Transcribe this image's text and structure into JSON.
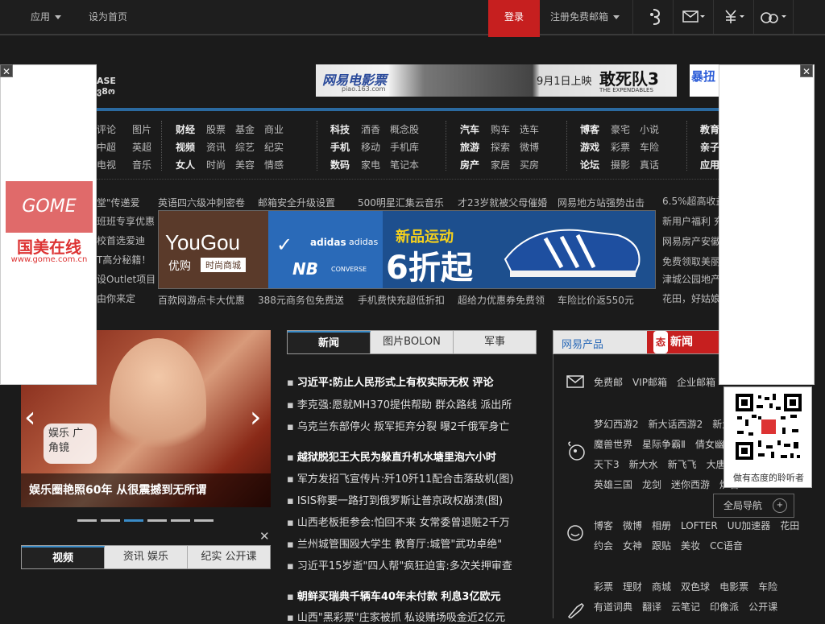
{
  "topbar": {
    "apps": "应用",
    "set_home": "设为首页",
    "login": "登录",
    "register": "注册免费邮箱"
  },
  "movie_ad": {
    "brand": "网易电影票",
    "site": "piao.163.com",
    "date": "9月1日上映",
    "title": "敢死队3",
    "subtitle": "THE EXPENDABLES"
  },
  "nav": {
    "col0": [
      [
        "评论",
        "图片"
      ],
      [
        "中超",
        "英超"
      ],
      [
        "电视",
        "音乐"
      ]
    ],
    "col1": [
      [
        "财经",
        "股票",
        "基金",
        "商业"
      ],
      [
        "视频",
        "资讯",
        "综艺",
        "纪实"
      ],
      [
        "女人",
        "时尚",
        "美容",
        "情感"
      ]
    ],
    "col2": [
      [
        "科技",
        "酒香",
        "概念股"
      ],
      [
        "手机",
        "移动",
        "手机库"
      ],
      [
        "数码",
        "家电",
        "笔记本"
      ]
    ],
    "col3": [
      [
        "汽车",
        "购车",
        "选车"
      ],
      [
        "旅游",
        "探索",
        "微博"
      ],
      [
        "房产",
        "家居",
        "买房"
      ]
    ],
    "col4": [
      [
        "博客",
        "豪宅",
        "小说"
      ],
      [
        "游戏",
        "彩票",
        "车险"
      ],
      [
        "论坛",
        "摄影",
        "真话"
      ]
    ],
    "col5": [
      "教育",
      "亲子",
      "应用"
    ]
  },
  "links_top": [
    "堂\"传递爱",
    "英语四六级冲刺密卷",
    "邮箱安全升级设置",
    "500明星汇集云音乐",
    "才23岁就被父母催婚",
    "网易地方站强势出击",
    "6.5%超高收益"
  ],
  "links_left": [
    "堂\"传递爱",
    "班班专享优惠",
    "校首选爱迪",
    "T高分秘籍！",
    "设Outlet项目",
    "由你来定"
  ],
  "links_right": [
    "新用户福利 充",
    "网易房产安徽",
    "免费领取美丽",
    "津城公园地产",
    "花田，好姑娘"
  ],
  "links_bottom": [
    "百款网游点卡大优惠",
    "388元商务包免费送",
    "手机费快充超低折扣",
    "超给力优惠券免费领",
    "车险比价返550元"
  ],
  "yougou_ad": {
    "brand": "YouGou",
    "brand_cn": "优购",
    "tag": "时尚商城",
    "promo": "新品运动",
    "discount": "6折起",
    "b1": "adidas",
    "b2": "adidas",
    "b3": "NB",
    "b4": "CONVERSE"
  },
  "gome_ad": {
    "logo": "GOME",
    "name": "国美在线",
    "url": "www.gome.com.cn"
  },
  "feature": {
    "badge": "娱乐 广角镜",
    "caption": "娱乐圈艳照60年 从很震撼到无所谓"
  },
  "news_tabs": [
    "新闻",
    "图片BOLON",
    "军事"
  ],
  "news": [
    {
      "text": "习近平:防止人民形式上有权实际无权 评论",
      "bold": true
    },
    {
      "text": "李克强:愿就MH370提供帮助 群众路线 派出所",
      "bold": false
    },
    {
      "text": "乌克兰东部停火 叛军拒弃分裂 曝2千俄军身亡",
      "bold": false
    },
    {
      "text": "越狱脱犯王大民为躲直升机水塘里泡六小时",
      "bold": true
    },
    {
      "text": "军方发招飞宣传片:歼10歼11配合击落敌机(图)",
      "bold": false
    },
    {
      "text": "ISIS称要一路打到俄罗斯让普京政权崩溃(图)",
      "bold": false
    },
    {
      "text": "山西老板拒参会:怕回不来 女常委曾退赃2千万",
      "bold": false
    },
    {
      "text": "兰州城管围殴大学生 教育厅:城管\"武功卓绝\"",
      "bold": false
    },
    {
      "text": "习近平15岁逝\"四人帮\"疯狂迫害:多次关押审查",
      "bold": false
    },
    {
      "text": "朝鲜买瑞典千辆车40年未付款 利息3亿欧元",
      "bold": true
    },
    {
      "text": "山西\"黑彩票\"庄家被抓 私设赌场吸金近2亿元",
      "bold": false
    }
  ],
  "video_tabs": [
    "视频",
    "资讯 娱乐",
    "纪实 公开课"
  ],
  "products": {
    "tab": "网易产品",
    "tab2": "新闻",
    "rows": [
      [
        "免费邮",
        "VIP邮箱",
        "企业邮箱"
      ],
      [
        "梦幻西游2",
        "新大话西游2",
        "新大"
      ],
      [
        "魔兽世界",
        "星际争霸Ⅱ",
        "倩女幽魂"
      ],
      [
        "天下3",
        "新大水",
        "新飞飞",
        "大唐无"
      ],
      [
        "英雄三国",
        "龙剑",
        "迷你西游",
        "炉石"
      ],
      [
        "博客",
        "微博",
        "相册",
        "LOFTER",
        "UU加速器",
        "花田"
      ],
      [
        "约会",
        "女神",
        "跟贴",
        "美妆",
        "CC语音"
      ],
      [
        "彩票",
        "理财",
        "商城",
        "双色球",
        "电影票",
        "车险"
      ],
      [
        "有道词典",
        "翻译",
        "云笔记",
        "印像派",
        "公开课"
      ]
    ]
  },
  "qr": {
    "caption": "做有态度的聆听者"
  },
  "global_nav": "全局导航",
  "colors": {
    "accent": "#c61f1f",
    "bg": "#1b1b1b",
    "link": "#3a8cc8"
  }
}
